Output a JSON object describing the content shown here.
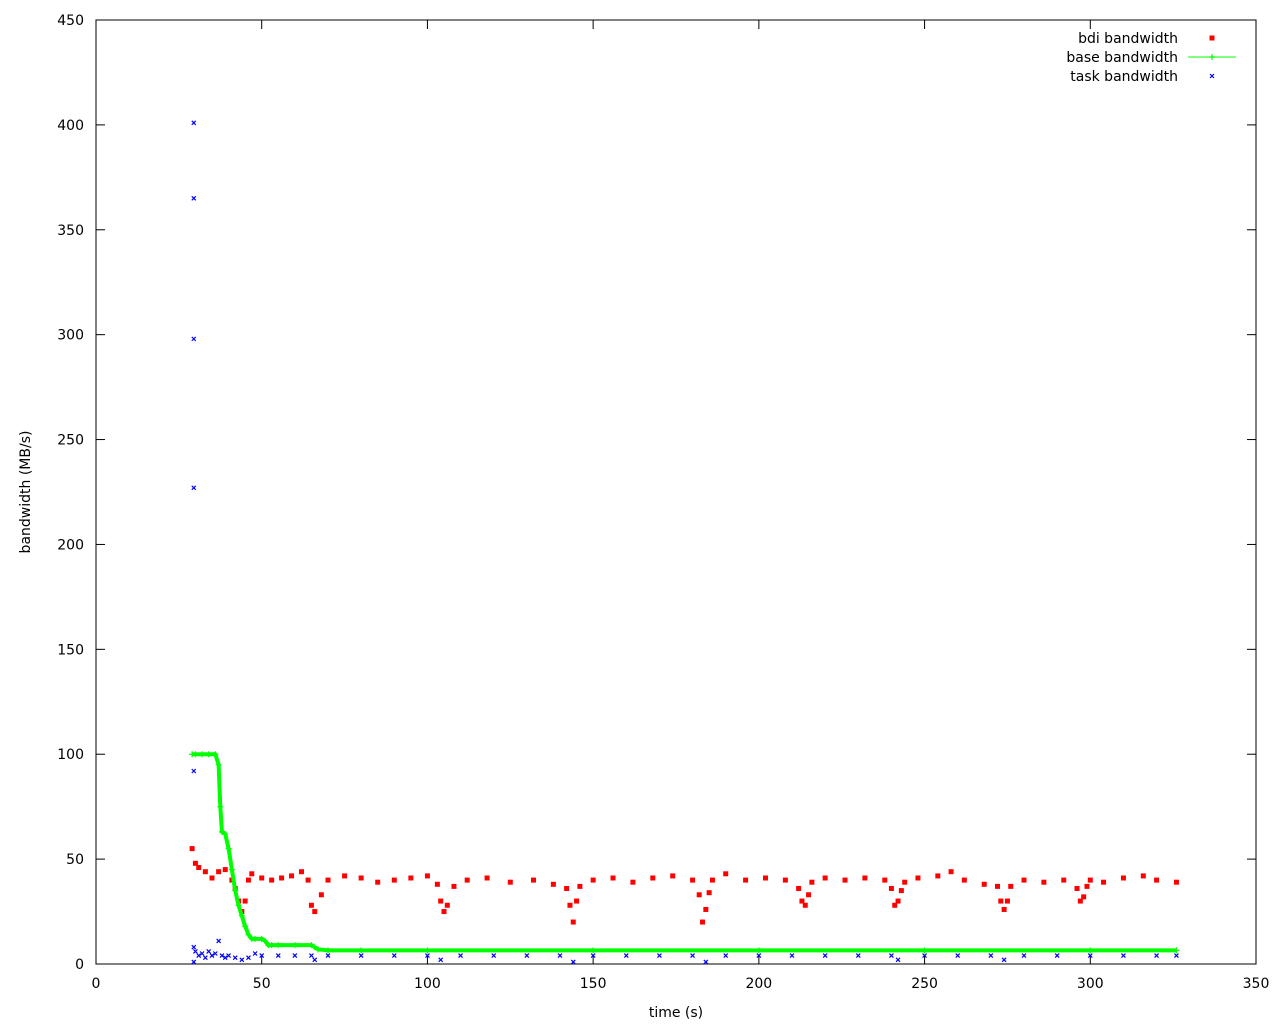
{
  "chart_data": {
    "type": "scatter",
    "title": "",
    "xlabel": "time (s)",
    "ylabel": "bandwidth (MB/s)",
    "xlim": [
      0,
      350
    ],
    "ylim": [
      0,
      450
    ],
    "xticks": [
      0,
      50,
      100,
      150,
      200,
      250,
      300,
      350
    ],
    "yticks": [
      0,
      50,
      100,
      150,
      200,
      250,
      300,
      350,
      400,
      450
    ],
    "grid": false,
    "legend_position": "top-right",
    "series": [
      {
        "name": "bdi bandwidth",
        "style": "points",
        "marker": "square",
        "color": "#ff0000",
        "x": [
          29,
          30,
          31,
          33,
          35,
          37,
          39,
          41,
          42,
          43,
          44,
          45,
          46,
          47,
          50,
          53,
          56,
          59,
          62,
          64,
          65,
          66,
          68,
          70,
          75,
          80,
          85,
          90,
          95,
          100,
          103,
          104,
          105,
          106,
          108,
          112,
          118,
          125,
          132,
          138,
          142,
          143,
          144,
          145,
          146,
          150,
          156,
          162,
          168,
          174,
          180,
          182,
          183,
          184,
          185,
          186,
          190,
          196,
          202,
          208,
          212,
          213,
          214,
          215,
          216,
          220,
          226,
          232,
          238,
          240,
          241,
          242,
          243,
          244,
          248,
          254,
          258,
          262,
          268,
          272,
          273,
          274,
          275,
          276,
          280,
          286,
          292,
          296,
          297,
          298,
          299,
          300,
          304,
          310,
          316,
          320,
          326
        ],
        "y": [
          55,
          48,
          46,
          44,
          41,
          44,
          45,
          40,
          36,
          30,
          25,
          30,
          40,
          43,
          41,
          40,
          41,
          42,
          44,
          40,
          28,
          25,
          33,
          40,
          42,
          41,
          39,
          40,
          41,
          42,
          38,
          30,
          25,
          28,
          37,
          40,
          41,
          39,
          40,
          38,
          36,
          28,
          20,
          30,
          37,
          40,
          41,
          39,
          41,
          42,
          40,
          33,
          20,
          26,
          34,
          40,
          43,
          40,
          41,
          40,
          36,
          30,
          28,
          33,
          39,
          41,
          40,
          41,
          40,
          36,
          28,
          30,
          35,
          39,
          41,
          42,
          44,
          40,
          38,
          37,
          30,
          26,
          30,
          37,
          40,
          39,
          40,
          36,
          30,
          32,
          37,
          40,
          39,
          41,
          42,
          40,
          39
        ]
      },
      {
        "name": "base bandwidth",
        "style": "linespoints",
        "marker": "plus",
        "color": "#00ff00",
        "x": [
          29,
          30,
          32,
          34,
          36,
          37,
          37.5,
          38,
          39,
          40,
          41,
          42,
          43,
          44,
          45,
          46,
          47,
          48,
          50,
          51,
          52,
          53,
          55,
          60,
          65,
          66,
          67,
          70,
          80,
          100,
          150,
          200,
          250,
          300,
          326
        ],
        "y": [
          100,
          100,
          100,
          100,
          100,
          95,
          75,
          63,
          62,
          55,
          45,
          35,
          28,
          23,
          18,
          14,
          12,
          12,
          12,
          11,
          9,
          9,
          9,
          9,
          9,
          8,
          7,
          6.5,
          6.5,
          6.5,
          6.5,
          6.5,
          6.5,
          6.5,
          6.5
        ]
      },
      {
        "name": "task bandwidth",
        "style": "points",
        "marker": "cross",
        "color": "#0000ff",
        "x": [
          29.5,
          29.5,
          29.5,
          29.5,
          29.5,
          29.5,
          29.5,
          30,
          31,
          32,
          33,
          34,
          35,
          36,
          37,
          38,
          39,
          40,
          42,
          44,
          46,
          48,
          50,
          55,
          60,
          65,
          66,
          70,
          80,
          90,
          100,
          104,
          110,
          120,
          130,
          140,
          144,
          150,
          160,
          170,
          180,
          184,
          190,
          200,
          210,
          220,
          230,
          240,
          242,
          250,
          260,
          270,
          274,
          280,
          290,
          300,
          310,
          320,
          326
        ],
        "y": [
          401,
          365,
          298,
          227,
          92,
          8,
          1,
          6,
          4,
          5,
          3,
          6,
          4,
          5,
          11,
          4,
          3,
          4,
          3,
          2,
          3,
          5,
          4,
          4,
          4,
          4,
          2,
          4,
          4,
          4,
          4,
          2,
          4,
          4,
          4,
          4,
          1,
          4,
          4,
          4,
          4,
          1,
          4,
          4,
          4,
          4,
          4,
          4,
          2,
          4,
          4,
          4,
          2,
          4,
          4,
          4,
          4,
          4,
          4
        ]
      }
    ]
  }
}
